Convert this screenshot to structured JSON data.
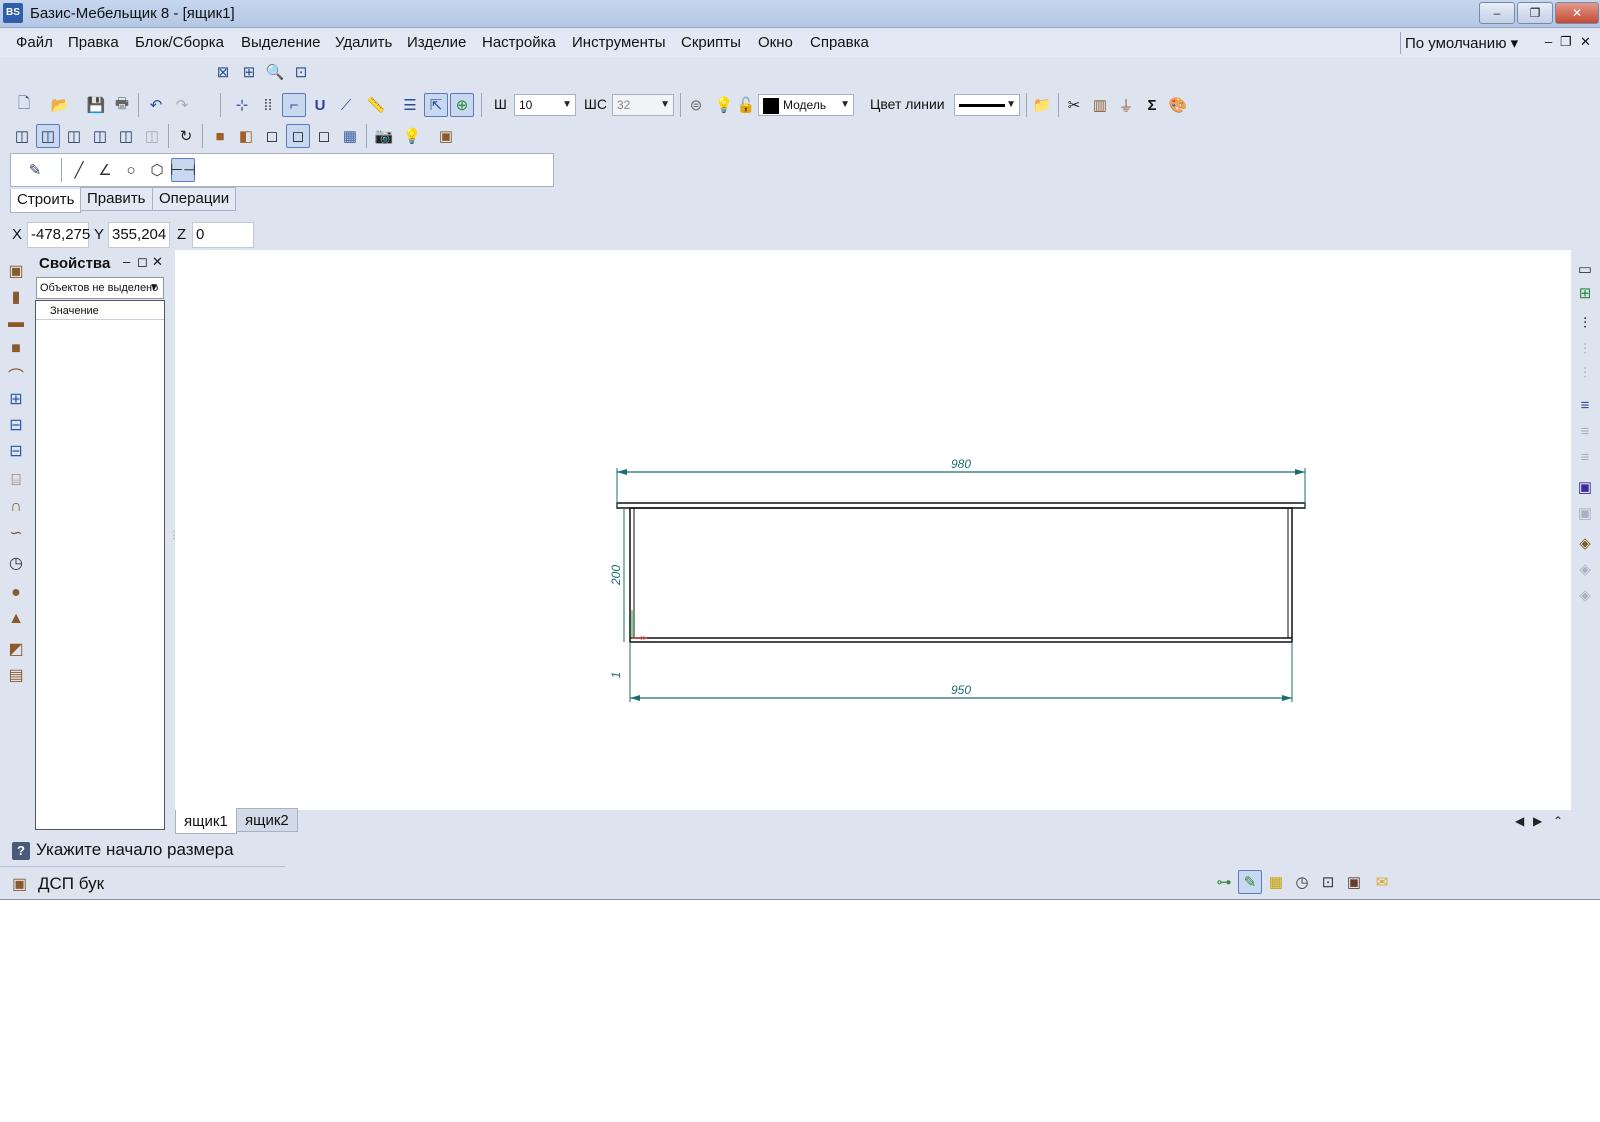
{
  "window": {
    "title": "Базис-Мебельщик 8 - [ящик1]",
    "app_icon_text": "BS",
    "minimize": "–",
    "restore": "❐",
    "close": "✕"
  },
  "menu": {
    "items": [
      "Файл",
      "Правка",
      "Блок/Сборка",
      "Выделение",
      "Удалить",
      "Изделие",
      "Настройка",
      "Инструменты",
      "Скрипты",
      "Окно",
      "Справка"
    ],
    "profile": "По умолчанию ▾",
    "mdi_min": "–",
    "mdi_restore": "❐",
    "mdi_close": "✕"
  },
  "toolbar": {
    "line_width_label": "Ш",
    "line_width_value": "10",
    "grid_step_label": "ШС",
    "grid_step_value": "32",
    "layer_value": "Модель",
    "line_color_label": "Цвет линии",
    "layer_color": "#000000"
  },
  "palette": {
    "tabs": [
      "Строить",
      "Править",
      "Операции"
    ]
  },
  "coords": {
    "x_label": "X",
    "x_value": "-478,275",
    "y_label": "Y",
    "y_value": "355,204",
    "z_label": "Z",
    "z_value": "0"
  },
  "properties": {
    "title": "Свойства",
    "pin": "–",
    "float": "◻",
    "close": "✕",
    "selection": "Объектов не выделено",
    "column_header": "Значение"
  },
  "drawing": {
    "dims": {
      "top_width": "980",
      "bottom_width": "950",
      "height": "200",
      "small": "1"
    },
    "dim_color": "#1a6f6a"
  },
  "doc_tabs": [
    "ящик1",
    "ящик2"
  ],
  "status": {
    "hint": "Укажите начало размера",
    "material": "ДСП бук"
  },
  "icons": {
    "toolbar1": [
      "new-icon",
      "open-icon",
      "save-icon",
      "print-icon",
      "undo-icon",
      "redo-icon",
      "snap-icon",
      "grid-icon",
      "ortho-icon",
      "magnet-icon",
      "measure-icon",
      "ruler-icon",
      "layers-icon",
      "select-icon",
      "transform-icon",
      "hatch-icon",
      "bulb-icon",
      "lock-icon",
      "folder-icon",
      "cut-icon",
      "door-icon",
      "stamp-icon",
      "sigma-icon",
      "paint-icon"
    ],
    "toolbar2": [
      "view-front-icon",
      "view-top-icon",
      "view-left-icon",
      "view-right-icon",
      "view-back-icon",
      "view-iso-icon",
      "rotate-icon",
      "material-icon",
      "solid-icon",
      "shaded-icon",
      "wire-icon",
      "hidden-icon",
      "split-view-icon",
      "camera-icon",
      "light-icon",
      "box-icon"
    ]
  }
}
